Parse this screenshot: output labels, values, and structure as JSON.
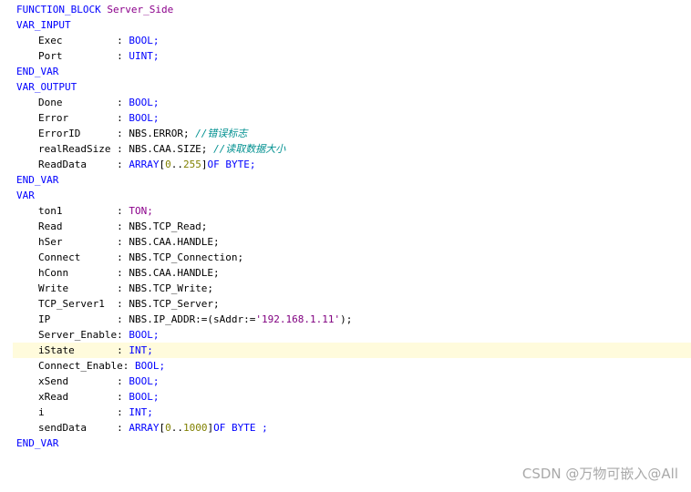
{
  "code": {
    "lines": [
      {
        "indent": 0,
        "tokens": [
          {
            "t": "FUNCTION_BLOCK ",
            "c": "kw"
          },
          {
            "t": "Server_Side",
            "c": "fb"
          }
        ]
      },
      {
        "indent": 0,
        "tokens": [
          {
            "t": "VAR_INPUT",
            "c": "kw"
          }
        ]
      },
      {
        "indent": 4,
        "tokens": [
          {
            "t": "Exec         : ",
            "c": "id"
          },
          {
            "t": "BOOL;",
            "c": "kw"
          }
        ]
      },
      {
        "indent": 4,
        "tokens": [
          {
            "t": "Port         : ",
            "c": "id"
          },
          {
            "t": "UINT;",
            "c": "kw"
          }
        ]
      },
      {
        "indent": 0,
        "tokens": [
          {
            "t": "END_VAR",
            "c": "kw"
          }
        ]
      },
      {
        "indent": 0,
        "tokens": [
          {
            "t": "VAR_OUTPUT",
            "c": "kw"
          }
        ]
      },
      {
        "indent": 4,
        "tokens": [
          {
            "t": "Done         : ",
            "c": "id"
          },
          {
            "t": "BOOL;",
            "c": "kw"
          }
        ]
      },
      {
        "indent": 4,
        "tokens": [
          {
            "t": "Error        : ",
            "c": "id"
          },
          {
            "t": "BOOL;",
            "c": "kw"
          }
        ]
      },
      {
        "indent": 4,
        "tokens": [
          {
            "t": "ErrorID      : NBS.ERROR; ",
            "c": "id"
          },
          {
            "t": "//错误标志",
            "c": "cm"
          }
        ]
      },
      {
        "indent": 4,
        "tokens": [
          {
            "t": "realReadSize : NBS.CAA.SIZE; ",
            "c": "id"
          },
          {
            "t": "//读取数据大小",
            "c": "cm"
          }
        ]
      },
      {
        "indent": 4,
        "tokens": [
          {
            "t": "ReadData     : ",
            "c": "id"
          },
          {
            "t": "ARRAY",
            "c": "kw"
          },
          {
            "t": "[",
            "c": "id"
          },
          {
            "t": "0",
            "c": "num"
          },
          {
            "t": "..",
            "c": "id"
          },
          {
            "t": "255",
            "c": "num"
          },
          {
            "t": "]",
            "c": "id"
          },
          {
            "t": "OF BYTE;",
            "c": "kw"
          }
        ]
      },
      {
        "indent": 0,
        "tokens": [
          {
            "t": "END_VAR",
            "c": "kw"
          }
        ]
      },
      {
        "indent": 0,
        "tokens": [
          {
            "t": "VAR",
            "c": "kw"
          }
        ]
      },
      {
        "indent": 4,
        "tokens": [
          {
            "t": "ton1         : ",
            "c": "id"
          },
          {
            "t": "TON;",
            "c": "fb"
          }
        ]
      },
      {
        "indent": 4,
        "tokens": [
          {
            "t": "Read         : NBS.TCP_Read;",
            "c": "id"
          }
        ]
      },
      {
        "indent": 4,
        "tokens": [
          {
            "t": "hSer         : NBS.CAA.HANDLE;",
            "c": "id"
          }
        ]
      },
      {
        "indent": 4,
        "tokens": [
          {
            "t": "Connect      : NBS.TCP_Connection;",
            "c": "id"
          }
        ]
      },
      {
        "indent": 4,
        "tokens": [
          {
            "t": "hConn        : NBS.CAA.HANDLE;",
            "c": "id"
          }
        ]
      },
      {
        "indent": 4,
        "tokens": [
          {
            "t": "Write        : NBS.TCP_Write;",
            "c": "id"
          }
        ]
      },
      {
        "indent": 4,
        "tokens": [
          {
            "t": "TCP_Server1  : NBS.TCP_Server;",
            "c": "id"
          }
        ]
      },
      {
        "indent": 4,
        "tokens": [
          {
            "t": "IP           : NBS.IP_ADDR:=(sAddr:=",
            "c": "id"
          },
          {
            "t": "'192.168.1.11'",
            "c": "str"
          },
          {
            "t": ");",
            "c": "id"
          }
        ]
      },
      {
        "indent": 4,
        "tokens": [
          {
            "t": "Server_Enable: ",
            "c": "id"
          },
          {
            "t": "BOOL;",
            "c": "kw"
          }
        ]
      },
      {
        "indent": 4,
        "hl": true,
        "tokens": [
          {
            "t": "iState       : ",
            "c": "id"
          },
          {
            "t": "INT;",
            "c": "kw"
          }
        ]
      },
      {
        "indent": 4,
        "tokens": [
          {
            "t": "Connect_Enable: ",
            "c": "id"
          },
          {
            "t": "BOOL;",
            "c": "kw"
          }
        ]
      },
      {
        "indent": 4,
        "tokens": [
          {
            "t": "xSend        : ",
            "c": "id"
          },
          {
            "t": "BOOL;",
            "c": "kw"
          }
        ]
      },
      {
        "indent": 4,
        "tokens": [
          {
            "t": "xRead        : ",
            "c": "id"
          },
          {
            "t": "BOOL;",
            "c": "kw"
          }
        ]
      },
      {
        "indent": 4,
        "tokens": [
          {
            "t": "i            : ",
            "c": "id"
          },
          {
            "t": "INT;",
            "c": "kw"
          }
        ]
      },
      {
        "indent": 4,
        "tokens": [
          {
            "t": "sendData     : ",
            "c": "id"
          },
          {
            "t": "ARRAY",
            "c": "kw"
          },
          {
            "t": "[",
            "c": "id"
          },
          {
            "t": "0",
            "c": "num"
          },
          {
            "t": "..",
            "c": "id"
          },
          {
            "t": "1000",
            "c": "num"
          },
          {
            "t": "]",
            "c": "id"
          },
          {
            "t": "OF BYTE ;",
            "c": "kw"
          }
        ]
      },
      {
        "indent": 0,
        "tokens": [
          {
            "t": "END_VAR",
            "c": "kw"
          }
        ]
      }
    ]
  },
  "watermark": "CSDN @万物可嵌入@All"
}
